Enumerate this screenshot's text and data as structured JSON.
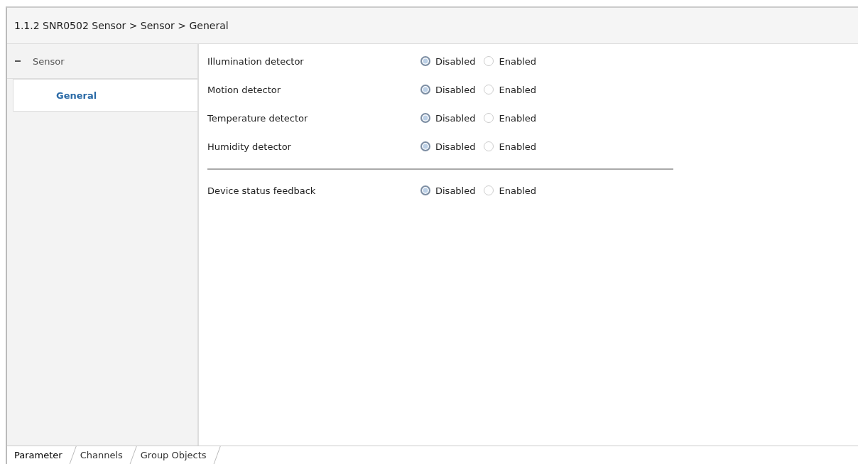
{
  "window": {
    "title": "1.1.2 SNR0502 Sensor > Sensor > General"
  },
  "sidebar": {
    "items": [
      {
        "label": "Sensor",
        "expanded": true,
        "selected": false,
        "children": [
          {
            "label": "General",
            "selected": true
          }
        ]
      }
    ]
  },
  "parameters": [
    {
      "label": "Illumination detector",
      "options": [
        {
          "label": "Disabled",
          "selected": true
        },
        {
          "label": "Enabled",
          "selected": false
        }
      ]
    },
    {
      "label": "Motion detector",
      "options": [
        {
          "label": "Disabled",
          "selected": true
        },
        {
          "label": "Enabled",
          "selected": false
        }
      ]
    },
    {
      "label": "Temperature detector",
      "options": [
        {
          "label": "Disabled",
          "selected": true
        },
        {
          "label": "Enabled",
          "selected": false
        }
      ]
    },
    {
      "label": "Humidity detector",
      "options": [
        {
          "label": "Disabled",
          "selected": true
        },
        {
          "label": "Enabled",
          "selected": false
        }
      ]
    },
    {
      "kind": "separator"
    },
    {
      "label": "Device status feedback",
      "options": [
        {
          "label": "Disabled",
          "selected": true
        },
        {
          "label": "Enabled",
          "selected": false
        }
      ]
    }
  ],
  "tabs": [
    {
      "label": "Parameter",
      "selected": true
    },
    {
      "label": "Channels",
      "selected": false
    },
    {
      "label": "Group Objects",
      "selected": false
    }
  ]
}
